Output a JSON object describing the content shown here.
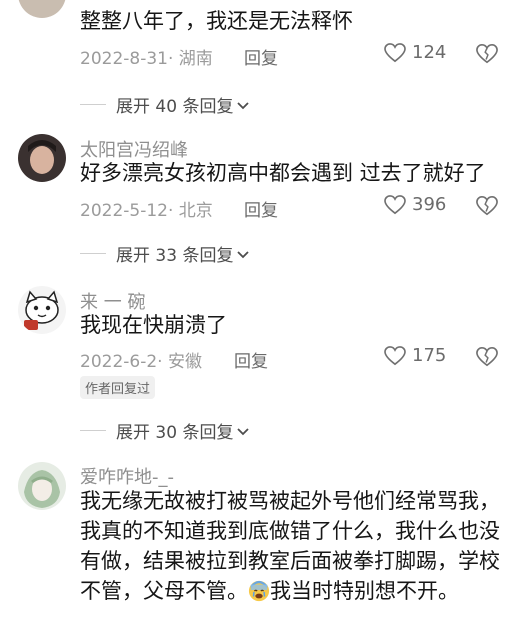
{
  "comments": [
    {
      "text": "整整八年了，我还是无法释怀",
      "date_location": "2022-8-31· 湖南",
      "reply_label": "回复",
      "likes": "124",
      "expand_label": "展开 40 条回复"
    },
    {
      "username": "太阳宫冯绍峰",
      "text": "好多漂亮女孩初高中都会遇到 过去了就好了",
      "date_location": "2022-5-12· 北京",
      "reply_label": "回复",
      "likes": "396",
      "expand_label": "展开 33 条回复"
    },
    {
      "username": "来 一 碗",
      "text": "我现在快崩溃了",
      "date_location": "2022-6-2· 安徽",
      "reply_label": "回复",
      "likes": "175",
      "badge": "作者回复过",
      "expand_label": "展开 30 条回复"
    },
    {
      "username": "爱咋咋地-_-",
      "text_part1": "我无缘无故被打被骂被起外号他们经常骂我，我真的不知道我到底做错了什么，我什么也没有做，结果被拉到教室后面被拳打脚踢，学校不管，父母不管。",
      "text_part2": "我当时特别想不开。"
    }
  ],
  "icons": {
    "like": "heart-outline-icon",
    "dislike": "broken-heart-icon",
    "expand": "chevron-down-icon",
    "emoji": "crying-face-emoji"
  },
  "colors": {
    "meta": "#9b9b9b",
    "username": "#8f8f8f",
    "text": "#161616"
  }
}
